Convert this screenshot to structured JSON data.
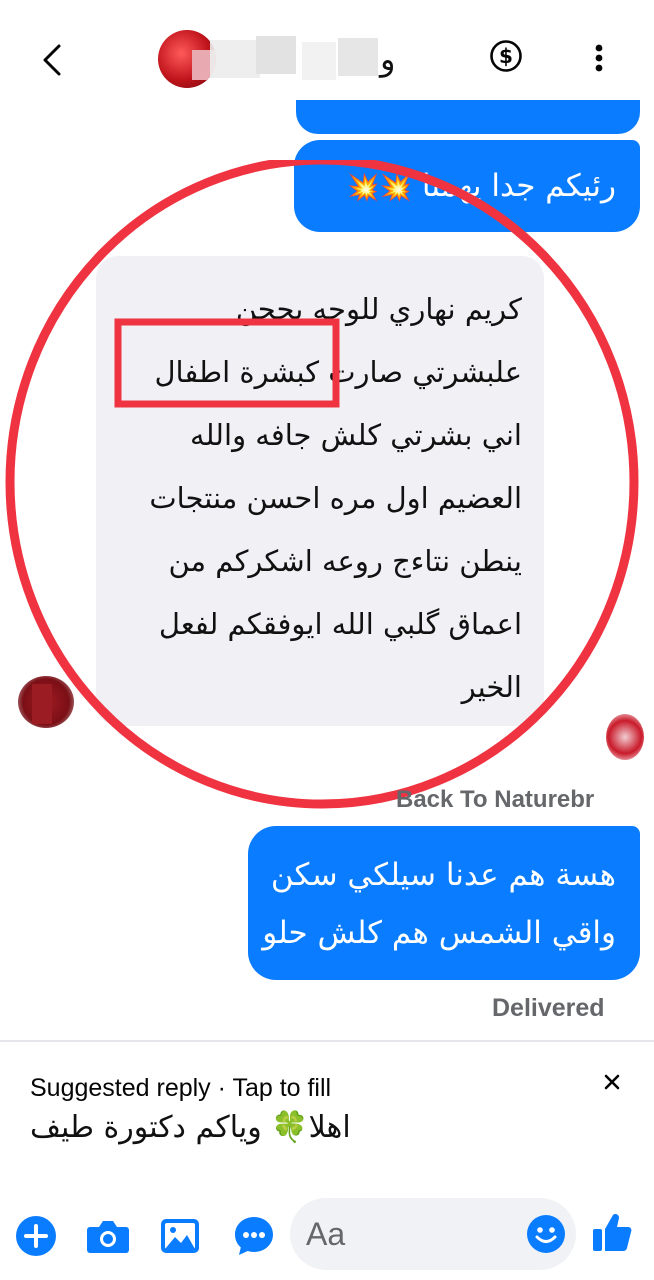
{
  "header": {
    "partial_name_glyph": "و"
  },
  "messages": {
    "outgoing_1": {
      "text": "رئيكم جدا يهمنا",
      "emojis": "💥💥"
    },
    "incoming_1": {
      "lines": [
        "كريم نهاري للوجه يججن",
        "علبشرتي صارت كبشرة اطفال",
        "اني بشرتي كلش جافه والله",
        "العضيم اول مره احسن منتجات",
        "ينطن نتاءج روعه اشكركم من",
        "اعماق گلبي الله ايوفقكم لفعل",
        "الخير"
      ]
    },
    "sender_label": "Back To Naturebr",
    "outgoing_2": {
      "lines": [
        "هسة هم عدنا سيلكي سكن",
        "واقي الشمس هم كلش حلو"
      ]
    },
    "status": "Delivered"
  },
  "suggested_reply": {
    "title": "Suggested reply · Tap to fill",
    "text_before": "اهلا",
    "emoji": "🍀",
    "text_after": "وياكم دكتورة طيف"
  },
  "composer": {
    "placeholder": "Aa"
  },
  "colors": {
    "messenger_blue": "#0a7cff",
    "incoming_bubble": "#f0f0f5",
    "annotation_red": "#ef3340"
  }
}
